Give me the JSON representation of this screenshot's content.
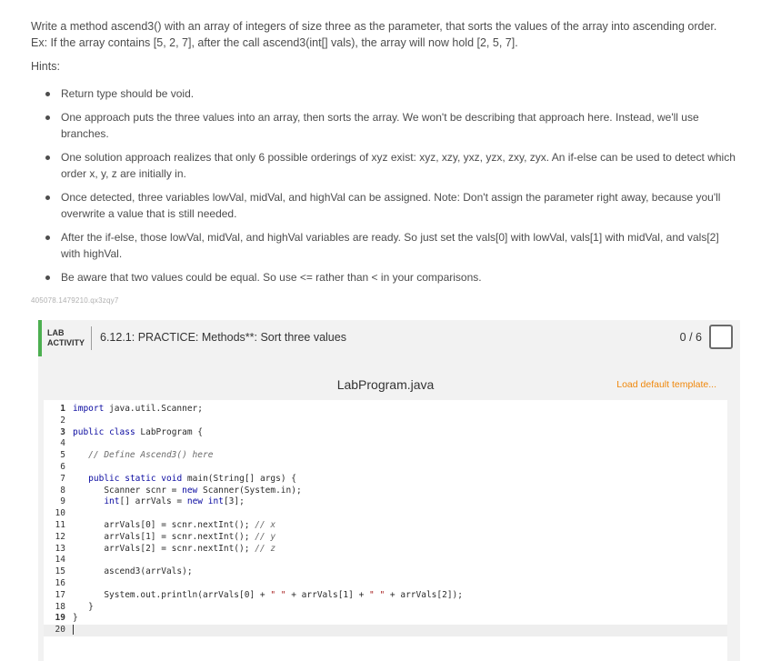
{
  "prompt": {
    "line1": "Write a method ascend3() with an array of integers of size three as the parameter, that sorts the values of the array into ascending order.",
    "line2": "Ex: If the array contains [5, 2, 7], after the call ascend3(int[] vals), the array will now hold [2, 5, 7]."
  },
  "hints_label": "Hints:",
  "hints": [
    "Return type should be void.",
    "One approach puts the three values into an array, then sorts the array. We won't be describing that approach here. Instead, we'll use branches.",
    "One solution approach realizes that only 6 possible orderings of xyz exist: xyz, xzy, yxz, yzx, zxy, zyx. An if-else can be used to detect which order x, y, z are initially in.",
    "Once detected, three variables lowVal, midVal, and highVal can be assigned. Note: Don't assign the parameter right away, because you'll overwrite a value that is still needed.",
    "After the if-else, those lowVal, midVal, and highVal variables are ready. So just set the vals[0] with lowVal, vals[1] with midVal, and vals[2] with highVal.",
    "Be aware that two values could be equal. So use <= rather than < in your comparisons."
  ],
  "tracking_id": "405078.1479210.qx3zqy7",
  "lab": {
    "tag_line1": "LAB",
    "tag_line2": "ACTIVITY",
    "title": "6.12.1: PRACTICE: Methods**: Sort three values",
    "score": "0 / 6",
    "accent_color": "#4caf50"
  },
  "editor": {
    "file_name": "LabProgram.java",
    "load_template": "Load default template...",
    "load_color": "#f0870a",
    "lines": [
      {
        "n": "1",
        "code": "import java.util.Scanner;"
      },
      {
        "n": "2",
        "code": ""
      },
      {
        "n": "3",
        "code": "public class LabProgram {"
      },
      {
        "n": "4",
        "code": ""
      },
      {
        "n": "5",
        "code": "   // Define Ascend3() here"
      },
      {
        "n": "6",
        "code": ""
      },
      {
        "n": "7",
        "code": "   public static void main(String[] args) {"
      },
      {
        "n": "8",
        "code": "      Scanner scnr = new Scanner(System.in);"
      },
      {
        "n": "9",
        "code": "      int[] arrVals = new int[3];"
      },
      {
        "n": "10",
        "code": ""
      },
      {
        "n": "11",
        "code": "      arrVals[0] = scnr.nextInt(); // x"
      },
      {
        "n": "12",
        "code": "      arrVals[1] = scnr.nextInt(); // y"
      },
      {
        "n": "13",
        "code": "      arrVals[2] = scnr.nextInt(); // z"
      },
      {
        "n": "14",
        "code": ""
      },
      {
        "n": "15",
        "code": "      ascend3(arrVals);"
      },
      {
        "n": "16",
        "code": ""
      },
      {
        "n": "17",
        "code": "      System.out.println(arrVals[0] + \" \" + arrVals[1] + \" \" + arrVals[2]);"
      },
      {
        "n": "18",
        "code": "   }"
      },
      {
        "n": "19",
        "code": "}"
      },
      {
        "n": "20",
        "code": ""
      }
    ],
    "active_line": "20"
  }
}
